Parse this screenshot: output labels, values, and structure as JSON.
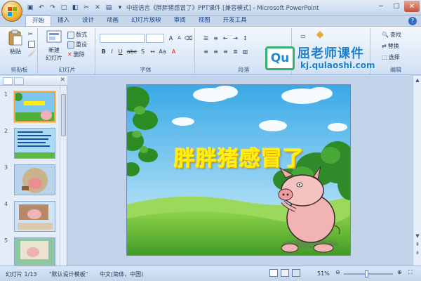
{
  "window": {
    "title": "中班语言《胖胖猪感冒了》PPT课件 [兼容模式] - Microsoft PowerPoint"
  },
  "tabs": [
    "开始",
    "插入",
    "设计",
    "动画",
    "幻灯片放映",
    "审阅",
    "视图",
    "开发工具"
  ],
  "ribbon": {
    "clipboard": {
      "label": "剪贴板",
      "paste": "粘贴"
    },
    "slides": {
      "label": "幻灯片",
      "new_slide_line1": "新建",
      "new_slide_line2": "幻灯片",
      "layout": "版式",
      "reset": "重设",
      "delete": "删除"
    },
    "font": {
      "label": "字体",
      "bold": "B",
      "italic": "I",
      "underline": "U",
      "strike": "abc",
      "shadow": "S"
    },
    "paragraph": {
      "label": "段落"
    },
    "editing": {
      "label": "编辑",
      "find": "查找",
      "replace": "替换",
      "select": "选择"
    }
  },
  "watermark": {
    "brand_box": "Qu",
    "brand_title": "屈老师课件",
    "url": "kj.qulaoshi.com"
  },
  "slides_pane": {
    "numbers": [
      "1",
      "2",
      "3",
      "4",
      "5"
    ],
    "selected": 1
  },
  "slide": {
    "title": "胖胖猪感冒了"
  },
  "statusbar": {
    "slide_info": "幻灯片 1/13",
    "theme": "\"默认设计模板\"",
    "language": "中文(简体，中国)",
    "zoom": "51%"
  },
  "colors": {
    "ribbon_bg": "#dbe8f7",
    "accent": "#15428b",
    "slide_title": "#fff200",
    "watermark": "#1a7ecc"
  }
}
